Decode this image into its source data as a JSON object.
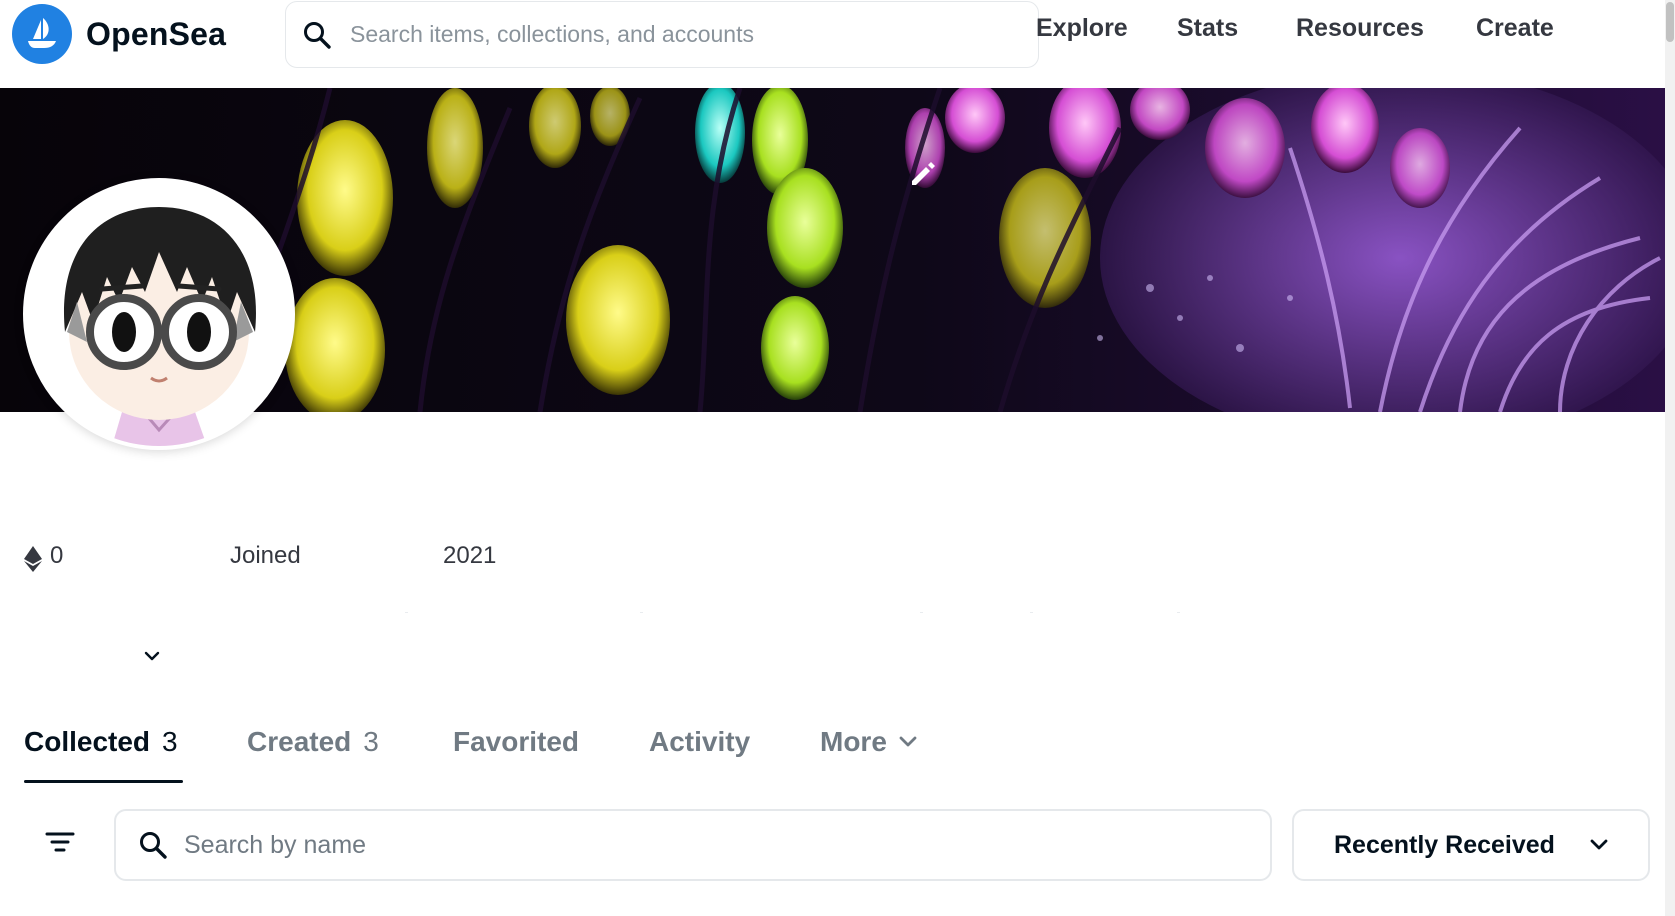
{
  "header": {
    "brand": "OpenSea",
    "search_placeholder": "Search items, collections, and accounts",
    "nav": [
      "Explore",
      "Stats",
      "Resources",
      "Create"
    ]
  },
  "profile": {
    "eth_balance": "0",
    "joined_label": "Joined",
    "joined_year": "2021"
  },
  "tabs": [
    {
      "label": "Collected",
      "count": "3",
      "active": true
    },
    {
      "label": "Created",
      "count": "3"
    },
    {
      "label": "Favorited"
    },
    {
      "label": "Activity"
    },
    {
      "label": "More"
    }
  ],
  "toolbar": {
    "name_search_placeholder": "Search by name",
    "sort_label": "Recently Received"
  },
  "icons": {
    "search": "search-icon",
    "edit": "pencil-icon",
    "filter": "filter-icon",
    "chevron": "chevron-down-icon",
    "eth": "ethereum-icon"
  },
  "colors": {
    "brand_blue": "#2081e2",
    "text_primary": "#04111d",
    "text_secondary": "#707a83",
    "border": "#e5e8eb"
  }
}
